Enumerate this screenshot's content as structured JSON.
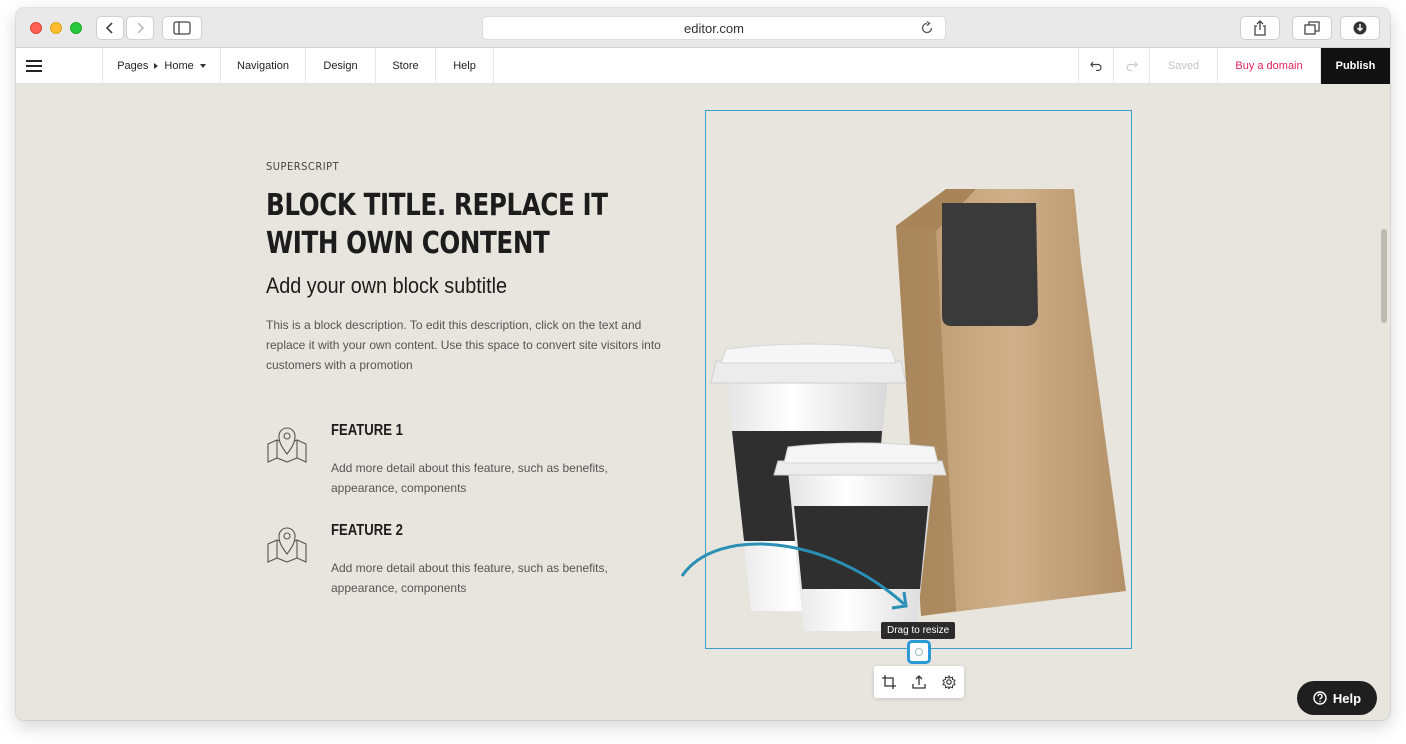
{
  "browser": {
    "url": "editor.com",
    "traffic_lights": [
      "close",
      "minimize",
      "zoom"
    ]
  },
  "appbar": {
    "menu_icon": "hamburger-icon",
    "pages_label": "Pages",
    "home_label": "Home",
    "navigation_label": "Navigation",
    "design_label": "Design",
    "store_label": "Store",
    "help_label": "Help",
    "saved_label": "Saved",
    "buy_domain_label": "Buy a domain",
    "publish_label": "Publish"
  },
  "block": {
    "superscript": "SUPERSCRIPT",
    "title": "BLOCK TITLE. REPLACE IT WITH OWN CONTENT",
    "subtitle": "Add your own block subtitle",
    "description": "This is a block description. To edit this description, click on the text and replace it with your own content. Use this space to convert site visitors into customers with a promotion",
    "features": [
      {
        "title": "FEATURE 1",
        "text": "Add more detail about this feature, such as benefits, appearance, components",
        "icon": "map-pin-icon"
      },
      {
        "title": "FEATURE 2",
        "text": "Add more detail about this feature, such as benefits, appearance, components",
        "icon": "map-pin-icon"
      }
    ]
  },
  "image_editor": {
    "tooltip": "Drag to resize",
    "tools": [
      "crop-icon",
      "upload-icon",
      "settings-icon"
    ]
  },
  "help_button": {
    "label": "Help"
  },
  "colors": {
    "page_bg": "#e8e5df",
    "selection": "#3ba0c9",
    "buy_domain": "#e0245e",
    "publish_bg": "#111111"
  }
}
